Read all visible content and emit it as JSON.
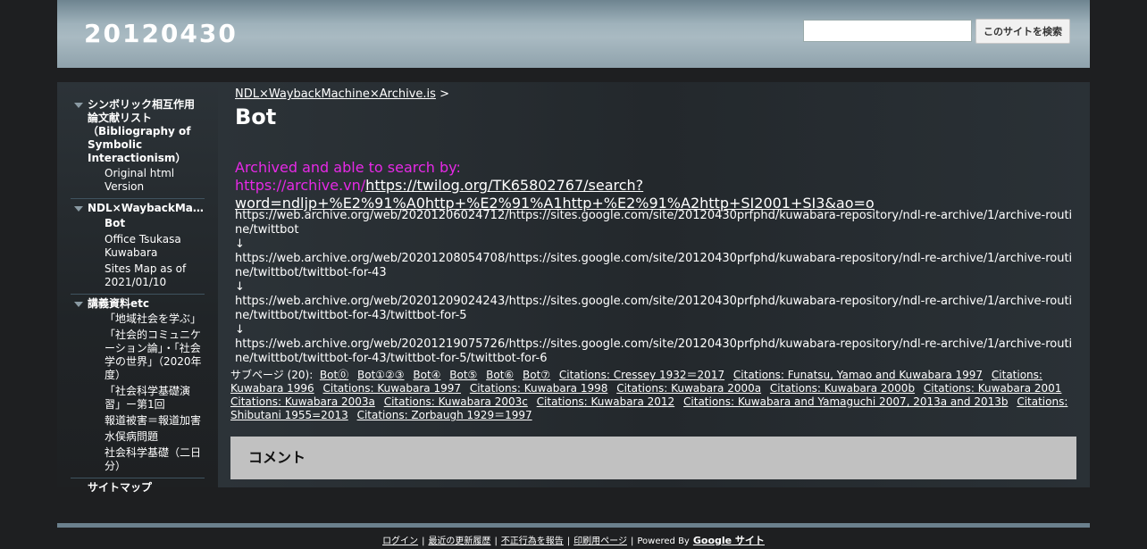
{
  "header": {
    "site_title": "20120430",
    "search_button": "このサイトを検索",
    "search_value": ""
  },
  "sidebar": {
    "groups": [
      {
        "label": "シンボリック相互作用論文献リスト（Bibliography of Symbolic Interactionism）",
        "children": [
          "Original html Version"
        ]
      },
      {
        "label": "NDL×WaybackMachine×Archive.is",
        "children": [
          "Bot",
          "Office Tsukasa Kuwabara",
          "Sites Map as of 2021/01/10"
        ]
      },
      {
        "label": "講義資料etc",
        "children": [
          "「地域社会を学ぶ」",
          "「社会的コミュニケーション論」・「社会学の世界」（2020年度）",
          "「社会科学基礎演習」ー第1回",
          "報道被害＝報道加害",
          "水俣病問題",
          "社会科学基礎（二日分）"
        ]
      }
    ],
    "sitemap": "サイトマップ"
  },
  "main": {
    "breadcrumb_link": "NDL×WaybackMachine×Archive.is",
    "breadcrumb_sep": ">",
    "title": "Bot",
    "archived_prefix": "Archived and able to search by: https://archive.vn/",
    "archived_link": "https://twilog.org/TK65802767/search?word=ndljp+%E2%91%A0http+%E2%91%A1http+%E2%91%A2http+SI2001+SI3&ao=o",
    "urls": [
      "https://web.archive.org/web/20201206024712/https://sites.google.com/site/20120430prfphd/kuwabara-repository/ndl-re-archive/1/archive-routine/twittbot",
      "↓",
      "https://web.archive.org/web/20201208054708/https://sites.google.com/site/20120430prfphd/kuwabara-repository/ndl-re-archive/1/archive-routine/twittbot/twittbot-for-43",
      "↓",
      "https://web.archive.org/web/20201209024243/https://sites.google.com/site/20120430prfphd/kuwabara-repository/ndl-re-archive/1/archive-routine/twittbot/twittbot-for-43/twittbot-for-5",
      "↓",
      "https://web.archive.org/web/20201219075726/https://sites.google.com/site/20120430prfphd/kuwabara-repository/ndl-re-archive/1/archive-routine/twittbot/twittbot-for-43/twittbot-for-5/twittbot-for-6"
    ],
    "subpages_label": "サブページ (20):",
    "subpages": [
      "Bot⓪",
      "Bot①②③",
      "Bot④",
      "Bot⑤",
      "Bot⑥",
      "Bot⑦",
      "Citations: Cressey 1932＝2017",
      "Citations: Funatsu, Yamao and Kuwabara 1997",
      "Citations: Kuwabara 1996",
      "Citations: Kuwabara 1997",
      "Citations: Kuwabara 1998",
      "Citations: Kuwabara 2000a",
      "Citations: Kuwabara 2000b",
      "Citations: Kuwabara 2001",
      "Citations: Kuwabara 2003a",
      "Citations: Kuwabara 2003c",
      "Citations: Kuwabara 2012",
      "Citations: Kuwabara and Yamaguchi 2007, 2013a and 2013b",
      "Citations: Shibutani 1955=2013",
      "Citations: Zorbaugh 1929＝1997"
    ],
    "comments_heading": "コメント"
  },
  "footer": {
    "links": [
      "ログイン",
      "最近の更新履歴",
      "不正行為を報告",
      "印刷用ページ"
    ],
    "powered_by": "Powered By",
    "google_sites": "Google サイト"
  }
}
